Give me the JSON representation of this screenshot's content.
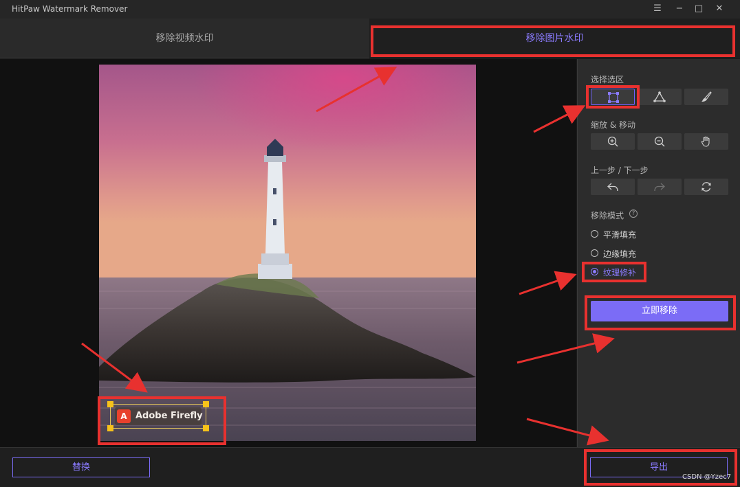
{
  "app": {
    "title": "HitPaw Watermark Remover"
  },
  "window_controls": {
    "menu": "☰",
    "minimize": "−",
    "maximize": "□",
    "close": "✕"
  },
  "tabs": [
    {
      "label": "移除视频水印",
      "active": false
    },
    {
      "label": "移除图片水印",
      "active": true
    }
  ],
  "panel": {
    "select_area_label": "选择选区",
    "select_tools": [
      "rectangle-select-icon",
      "polygon-select-icon",
      "brush-select-icon"
    ],
    "zoom_move_label": "缩放 & 移动",
    "zoom_tools": [
      "zoom-in-icon",
      "zoom-out-icon",
      "hand-icon"
    ],
    "undo_redo_label": "上一步 / 下一步",
    "history_tools": [
      "undo-icon",
      "redo-icon",
      "reset-icon"
    ],
    "remove_mode_label": "移除模式",
    "help_glyph": "?",
    "modes": [
      {
        "label": "平滑填充",
        "checked": false
      },
      {
        "label": "边缘填充",
        "checked": false
      },
      {
        "label": "纹理修补",
        "checked": true
      }
    ],
    "remove_now_label": "立即移除"
  },
  "image": {
    "watermark_text": "Adobe Firefly",
    "watermark_logo_glyph": "A"
  },
  "footer": {
    "replace_label": "替换",
    "export_label": "导出",
    "credit": "CSDN @Yzec7"
  },
  "colors": {
    "accent": "#7b6cf6",
    "highlight_red": "#e8312f",
    "background": "#1b1b1b",
    "panel": "#2c2c2c"
  }
}
